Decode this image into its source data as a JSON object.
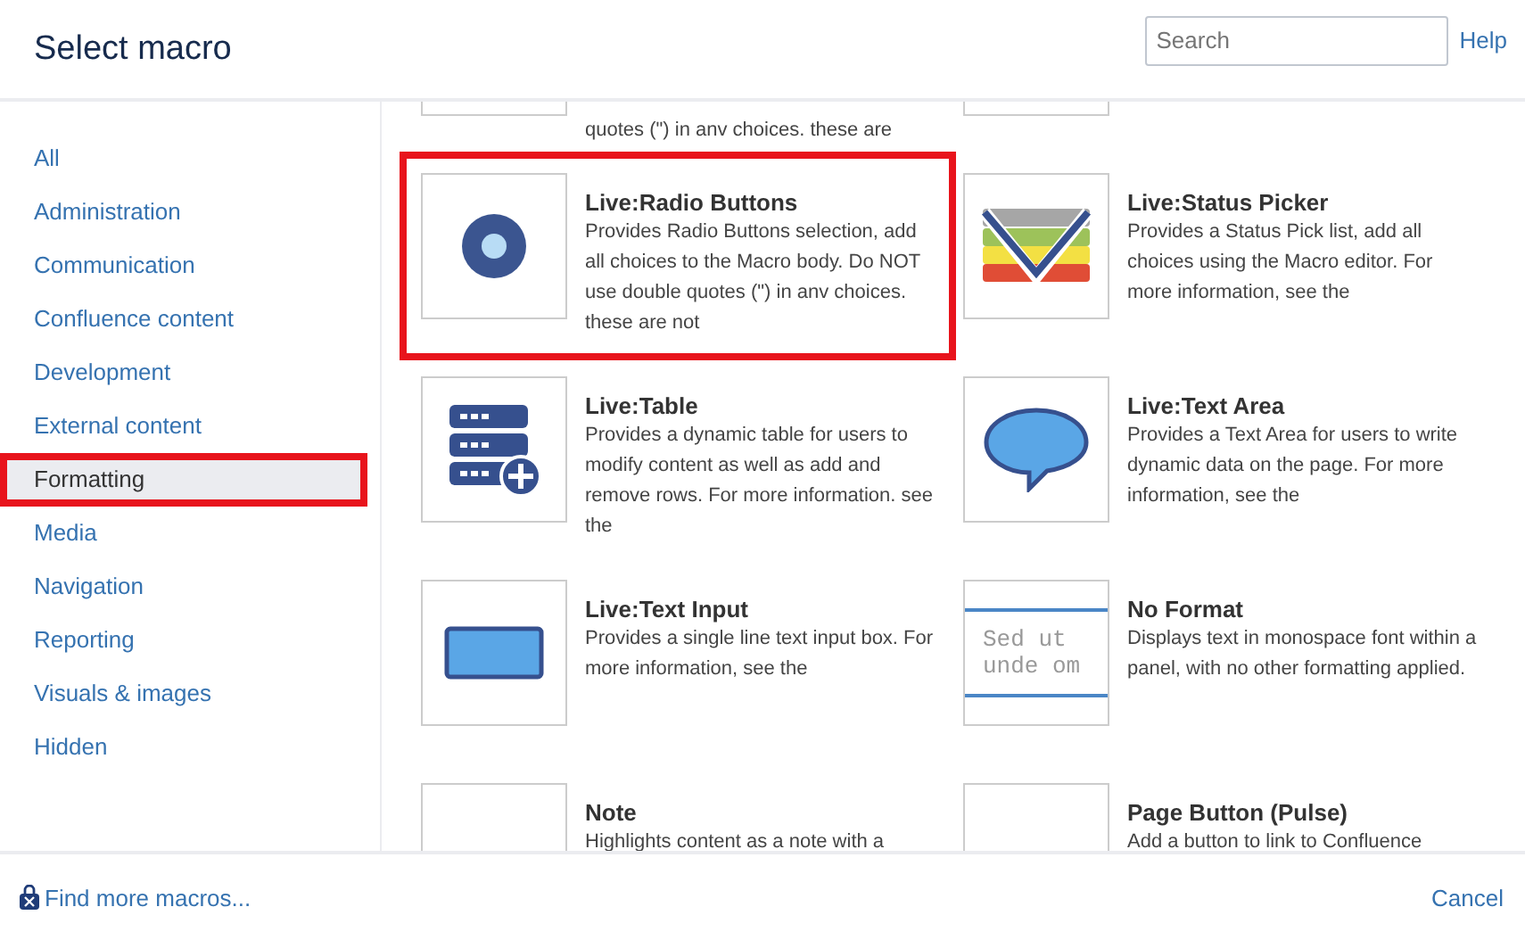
{
  "dialog": {
    "title": "Select macro",
    "search": {
      "placeholder": "Search"
    },
    "help": "Help"
  },
  "sidebar": {
    "items": [
      {
        "label": "All",
        "selected": false,
        "highlighted": false
      },
      {
        "label": "Administration",
        "selected": false,
        "highlighted": false
      },
      {
        "label": "Communication",
        "selected": false,
        "highlighted": false
      },
      {
        "label": "Confluence content",
        "selected": false,
        "highlighted": false
      },
      {
        "label": "Development",
        "selected": false,
        "highlighted": false
      },
      {
        "label": "External content",
        "selected": false,
        "highlighted": false
      },
      {
        "label": "Formatting",
        "selected": true,
        "highlighted": true
      },
      {
        "label": "Media",
        "selected": false,
        "highlighted": false
      },
      {
        "label": "Navigation",
        "selected": false,
        "highlighted": false
      },
      {
        "label": "Reporting",
        "selected": false,
        "highlighted": false
      },
      {
        "label": "Visuals & images",
        "selected": false,
        "highlighted": false
      },
      {
        "label": "Hidden",
        "selected": false,
        "highlighted": false
      }
    ]
  },
  "macros": [
    {
      "kind": "partial",
      "description": "quotes (\") in anv choices. these are",
      "highlighted": false
    },
    {
      "kind": "partial",
      "highlighted": false
    },
    {
      "kind": "radio",
      "title": "Live:Radio Buttons",
      "description": "Provides Radio Buttons selection, add all choices to the Macro body. Do NOT use double quotes (\") in anv choices. these are not",
      "highlighted": true
    },
    {
      "kind": "status",
      "title": "Live:Status Picker",
      "description": "Provides a Status Pick list, add all choices using the Macro editor. For more information, see the",
      "highlighted": false
    },
    {
      "kind": "table",
      "title": "Live:Table",
      "description": "Provides a dynamic table for users to modify content as well as add and remove rows. For more information. see the",
      "highlighted": false
    },
    {
      "kind": "textarea",
      "title": "Live:Text Area",
      "description": "Provides a Text Area for users to write dynamic data on the page. For more information, see the",
      "highlighted": false
    },
    {
      "kind": "textinput",
      "title": "Live:Text Input",
      "description": "Provides a single line text input box. For more information, see the",
      "highlighted": false
    },
    {
      "kind": "noformat",
      "title": "No Format",
      "description": "Displays text in monospace font within a panel, with no other formatting applied.",
      "preview_lines": [
        "Sed ut",
        "unde om"
      ],
      "highlighted": false
    },
    {
      "kind": "note",
      "title": "Note",
      "description": "Highlights content as a note with a",
      "highlighted": false
    },
    {
      "kind": "pagebutton",
      "title": "Page Button (Pulse)",
      "description": "Add a button to link to Confluence",
      "highlighted": false
    }
  ],
  "footer": {
    "link": "Find more macros...",
    "cancel": "Cancel"
  }
}
